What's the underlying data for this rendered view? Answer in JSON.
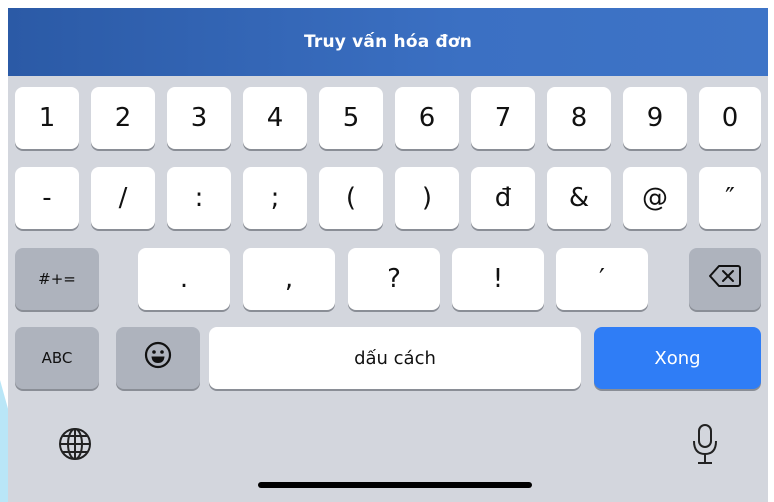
{
  "header": {
    "title": "Truy vấn hóa đơn"
  },
  "keyboard": {
    "row1": [
      "1",
      "2",
      "3",
      "4",
      "5",
      "6",
      "7",
      "8",
      "9",
      "0"
    ],
    "row2": [
      "-",
      "/",
      ":",
      ";",
      "(",
      ")",
      "đ",
      "&",
      "@",
      "″"
    ],
    "row3": {
      "symbols_toggle": "#+=",
      "keys": [
        ".",
        ",",
        "?",
        "!",
        "′"
      ]
    },
    "row4": {
      "abc": "ABC",
      "space": "dấu cách",
      "done": "Xong"
    },
    "icons": {
      "emoji": "emoji-icon",
      "backspace": "backspace-icon",
      "globe": "globe-icon",
      "mic": "microphone-icon"
    }
  },
  "colors": {
    "header": "#3b70c3",
    "keyboard_bg": "#d3d6dd",
    "done_key": "#2f7df6",
    "function_key": "#aeb3bd"
  }
}
